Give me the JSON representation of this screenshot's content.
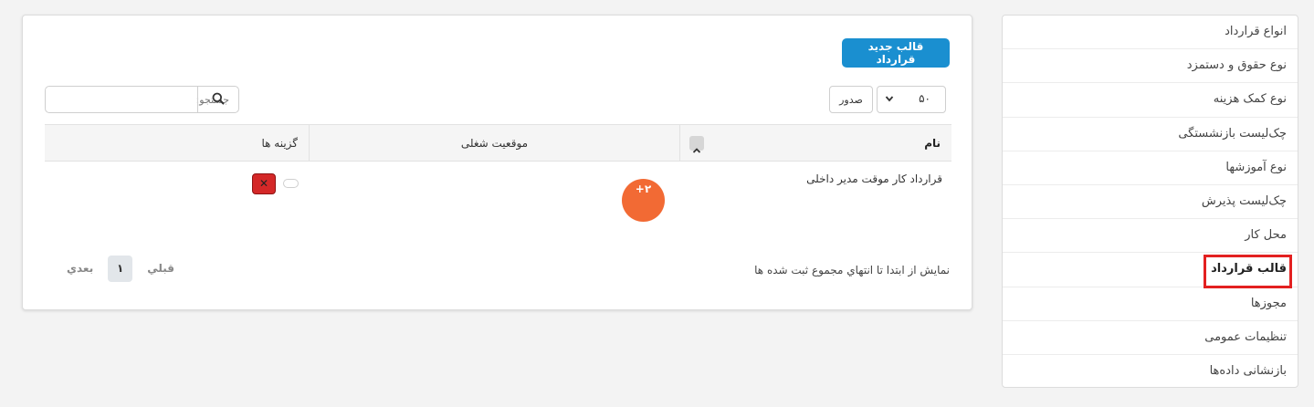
{
  "sidebar": {
    "items": [
      {
        "label": "انواع قرارداد"
      },
      {
        "label": "نوع حقوق و دستمزد"
      },
      {
        "label": "نوع کمک هزینه"
      },
      {
        "label": "چک‌لیست بازنشستگی"
      },
      {
        "label": "نوع آموزشها"
      },
      {
        "label": "چک‌لیست پذیرش"
      },
      {
        "label": "محل کار"
      },
      {
        "label": "قالب قرارداد"
      },
      {
        "label": "مجوزها"
      },
      {
        "label": "تنظیمات عمومی"
      },
      {
        "label": "بازنشانی داده‌ها"
      }
    ],
    "active_index": 7
  },
  "toolbar": {
    "new_button_label": "قالب جديد قرارداد",
    "page_length_value": "۵۰",
    "export_label": "صدور",
    "search_placeholder": "جستجو:"
  },
  "table": {
    "columns": [
      "نام",
      "موقعيت شغلی",
      "گزينه ها"
    ],
    "rows": [
      {
        "name": "قرارداد کار موقت مدير داخلی",
        "position_badge": "۲+"
      }
    ]
  },
  "footer": {
    "info": "نمايش از ابتدا تا انتهاي مجموع ثبت شده ها",
    "prev_label": "قبلي",
    "current_page": "۱",
    "next_label": "بعدي"
  },
  "colors": {
    "primary": "#1a8fd0",
    "avatar": "#f26a34",
    "danger": "#d42828",
    "highlight": "#e32020"
  }
}
